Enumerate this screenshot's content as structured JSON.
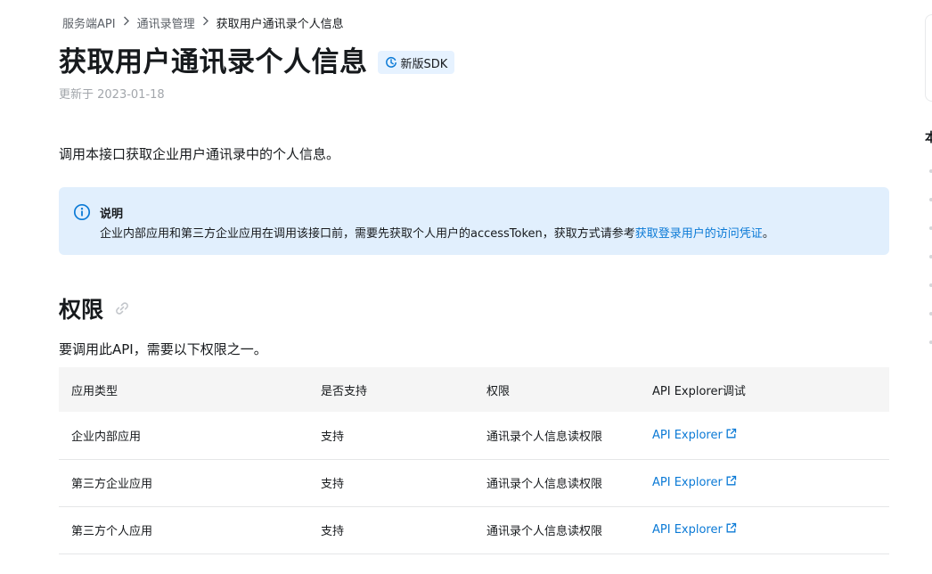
{
  "breadcrumb": {
    "items": [
      "服务端API",
      "通讯录管理",
      "获取用户通讯录个人信息"
    ],
    "separator": ">"
  },
  "page": {
    "title": "获取用户通讯录个人信息",
    "badge_label": "新版SDK",
    "updated": "更新于 2023-01-18",
    "intro": "调用本接口获取企业用户通讯录中的个人信息。"
  },
  "note": {
    "title": "说明",
    "text": "企业内部应用和第三方企业应用在调用该接口前，需要先获取个人用户的accessToken，获取方式请参考",
    "link": "获取登录用户的访问凭证",
    "end": "。",
    "icon": "info-icon",
    "bg_color": "#e1effd",
    "icon_color": "#0b7ad6"
  },
  "permissions": {
    "heading": "权限",
    "intro": "要调用此API，需要以下权限之一。",
    "columns": [
      "应用类型",
      "是否支持",
      "权限",
      "API Explorer调试"
    ],
    "rows": [
      {
        "type": "企业内部应用",
        "support": "支持",
        "perm": "通讯录个人信息读权限",
        "explorer": "API Explorer"
      },
      {
        "type": "第三方企业应用",
        "support": "支持",
        "perm": "通讯录个人信息读权限",
        "explorer": "API Explorer"
      },
      {
        "type": "第三方个人应用",
        "support": "支持",
        "perm": "通讯录个人信息读权限",
        "explorer": "API Explorer"
      }
    ]
  },
  "toc": {
    "head": "本"
  },
  "colors": {
    "link": "#0b7ad6",
    "text": "#171a1d",
    "muted": "#a2a6ab"
  }
}
